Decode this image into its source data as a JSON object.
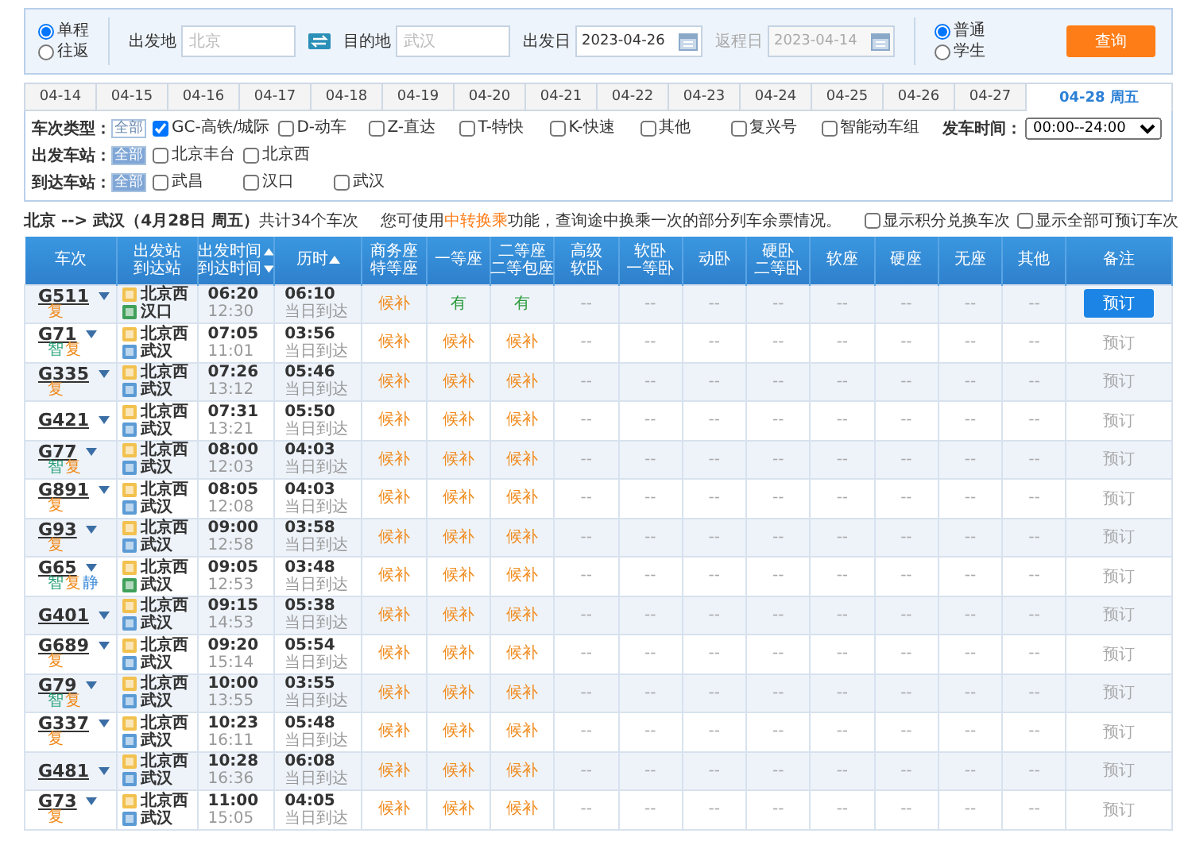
{
  "trip_type": [
    {
      "label": "单程",
      "selected": true
    },
    {
      "label": "往返",
      "selected": false
    }
  ],
  "from": {
    "label": "出发地",
    "placeholder": "北京"
  },
  "to": {
    "label": "目的地",
    "placeholder": "武汉"
  },
  "depart_date": {
    "label": "出发日",
    "value": "2023-04-26",
    "disabled": false
  },
  "return_date": {
    "label": "返程日",
    "value": "2023-04-14",
    "disabled": true
  },
  "passenger": [
    {
      "label": "普通",
      "selected": true
    },
    {
      "label": "学生",
      "selected": false
    }
  ],
  "search_button": "查询",
  "date_tabs": [
    {
      "label": "04-14",
      "selected": false
    },
    {
      "label": "04-15",
      "selected": false
    },
    {
      "label": "04-16",
      "selected": false
    },
    {
      "label": "04-17",
      "selected": false
    },
    {
      "label": "04-18",
      "selected": false
    },
    {
      "label": "04-19",
      "selected": false
    },
    {
      "label": "04-20",
      "selected": false
    },
    {
      "label": "04-21",
      "selected": false
    },
    {
      "label": "04-22",
      "selected": false
    },
    {
      "label": "04-23",
      "selected": false
    },
    {
      "label": "04-24",
      "selected": false
    },
    {
      "label": "04-25",
      "selected": false
    },
    {
      "label": "04-26",
      "selected": false
    },
    {
      "label": "04-27",
      "selected": false
    },
    {
      "label": "04-28 周五",
      "selected": true
    }
  ],
  "filters": {
    "rows": [
      {
        "label": "车次类型：",
        "all": {
          "label": "全部",
          "selected": false
        },
        "options": [
          {
            "label": "GC-高铁/城际",
            "checked": true
          },
          {
            "label": "D-动车",
            "checked": false
          },
          {
            "label": "Z-直达",
            "checked": false
          },
          {
            "label": "T-特快",
            "checked": false
          },
          {
            "label": "K-快速",
            "checked": false
          },
          {
            "label": "其他",
            "checked": false
          },
          {
            "label": "复兴号",
            "checked": false
          },
          {
            "label": "智能动车组",
            "checked": false
          }
        ]
      },
      {
        "label": "出发车站：",
        "all": {
          "label": "全部",
          "selected": true
        },
        "options": [
          {
            "label": "北京丰台",
            "checked": false
          },
          {
            "label": "北京西",
            "checked": false
          }
        ]
      },
      {
        "label": "到达车站：",
        "all": {
          "label": "全部",
          "selected": true
        },
        "options": [
          {
            "label": "武昌",
            "checked": false
          },
          {
            "label": "汉口",
            "checked": false
          },
          {
            "label": "武汉",
            "checked": false
          }
        ]
      }
    ],
    "time": {
      "label": "发车时间：",
      "value": "00:00--24:00"
    }
  },
  "summary": "**北京 --> 武汉（4月28日 周五）**共计34个车次",
  "notice": {
    "before": "您可使用",
    "link": "中转换乘",
    "after": "功能，查询途中换乘一次的部分列车余票情况。"
  },
  "toggles": [
    {
      "label": "显示积分兑换车次",
      "checked": false
    },
    {
      "label": "显示全部可预订车次",
      "checked": false
    }
  ],
  "table": {
    "columns": [
      {
        "lines": [
          {
            "text": "车次"
          }
        ]
      },
      {
        "lines": [
          {
            "text": "出发站"
          },
          {
            "text": "到达站"
          }
        ]
      },
      {
        "lines": [
          {
            "text": "出发时间",
            "sort_up": true
          },
          {
            "text": "到达时间",
            "sort_up": false
          }
        ]
      },
      {
        "lines": [
          {
            "text": "历时",
            "sort_up": true
          }
        ]
      },
      {
        "lines": [
          {
            "text": "商务座"
          },
          {
            "text": "特等座"
          }
        ]
      },
      {
        "lines": [
          {
            "text": "一等座"
          }
        ]
      },
      {
        "lines": [
          {
            "text": "二等座"
          },
          {
            "text": "二等包座"
          }
        ]
      },
      {
        "lines": [
          {
            "text": "高级"
          },
          {
            "text": "软卧"
          }
        ]
      },
      {
        "lines": [
          {
            "text": "软卧"
          },
          {
            "text": "一等卧"
          }
        ]
      },
      {
        "lines": [
          {
            "text": "动卧"
          }
        ]
      },
      {
        "lines": [
          {
            "text": "硬卧"
          },
          {
            "text": "二等卧"
          }
        ]
      },
      {
        "lines": [
          {
            "text": "软座"
          }
        ]
      },
      {
        "lines": [
          {
            "text": "硬座"
          }
        ]
      },
      {
        "lines": [
          {
            "text": "无座"
          }
        ]
      },
      {
        "lines": [
          {
            "text": "其他"
          }
        ]
      },
      {
        "lines": [
          {
            "text": "备注"
          }
        ]
      }
    ],
    "rows": [
      {
        "train": "G511",
        "tags": [
          {
            "text": "复",
            "kind": "fuxing"
          }
        ],
        "from": {
          "name": "北京西",
          "kind": "start"
        },
        "to": {
          "name": "汉口",
          "kind": "end"
        },
        "depart": "06:20",
        "arrive": "12:30",
        "duration": "06:10",
        "arrival_day": "当日到达",
        "seats": [
          {
            "text": "候补",
            "kind": "waitlist"
          },
          {
            "text": "有",
            "kind": "available"
          },
          {
            "text": "有",
            "kind": "available"
          },
          {
            "text": "--",
            "kind": "none"
          },
          {
            "text": "--",
            "kind": "none"
          },
          {
            "text": "--",
            "kind": "none"
          },
          {
            "text": "--",
            "kind": "none"
          },
          {
            "text": "--",
            "kind": "none"
          },
          {
            "text": "--",
            "kind": "none"
          },
          {
            "text": "--",
            "kind": "none"
          },
          {
            "text": "--",
            "kind": "none"
          }
        ],
        "book": {
          "label": "预订",
          "highlighted": true
        }
      },
      {
        "train": "G71",
        "tags": [
          {
            "text": "智",
            "kind": "smart"
          },
          {
            "text": "复",
            "kind": "fuxing"
          }
        ],
        "from": {
          "name": "北京西",
          "kind": "start"
        },
        "to": {
          "name": "武汉",
          "kind": "pass"
        },
        "depart": "07:05",
        "arrive": "11:01",
        "duration": "03:56",
        "arrival_day": "当日到达",
        "seats": [
          {
            "text": "候补",
            "kind": "waitlist"
          },
          {
            "text": "候补",
            "kind": "waitlist"
          },
          {
            "text": "候补",
            "kind": "waitlist"
          },
          {
            "text": "--",
            "kind": "none"
          },
          {
            "text": "--",
            "kind": "none"
          },
          {
            "text": "--",
            "kind": "none"
          },
          {
            "text": "--",
            "kind": "none"
          },
          {
            "text": "--",
            "kind": "none"
          },
          {
            "text": "--",
            "kind": "none"
          },
          {
            "text": "--",
            "kind": "none"
          },
          {
            "text": "--",
            "kind": "none"
          }
        ],
        "book": {
          "label": "预订",
          "highlighted": false
        }
      },
      {
        "train": "G335",
        "tags": [
          {
            "text": "复",
            "kind": "fuxing"
          }
        ],
        "from": {
          "name": "北京西",
          "kind": "start"
        },
        "to": {
          "name": "武汉",
          "kind": "pass"
        },
        "depart": "07:26",
        "arrive": "13:12",
        "duration": "05:46",
        "arrival_day": "当日到达",
        "seats": [
          {
            "text": "候补",
            "kind": "waitlist"
          },
          {
            "text": "候补",
            "kind": "waitlist"
          },
          {
            "text": "候补",
            "kind": "waitlist"
          },
          {
            "text": "--",
            "kind": "none"
          },
          {
            "text": "--",
            "kind": "none"
          },
          {
            "text": "--",
            "kind": "none"
          },
          {
            "text": "--",
            "kind": "none"
          },
          {
            "text": "--",
            "kind": "none"
          },
          {
            "text": "--",
            "kind": "none"
          },
          {
            "text": "--",
            "kind": "none"
          },
          {
            "text": "--",
            "kind": "none"
          }
        ],
        "book": {
          "label": "预订",
          "highlighted": false
        }
      },
      {
        "train": "G421",
        "tags": [],
        "from": {
          "name": "北京西",
          "kind": "start"
        },
        "to": {
          "name": "武汉",
          "kind": "pass"
        },
        "depart": "07:31",
        "arrive": "13:21",
        "duration": "05:50",
        "arrival_day": "当日到达",
        "seats": [
          {
            "text": "候补",
            "kind": "waitlist"
          },
          {
            "text": "候补",
            "kind": "waitlist"
          },
          {
            "text": "候补",
            "kind": "waitlist"
          },
          {
            "text": "--",
            "kind": "none"
          },
          {
            "text": "--",
            "kind": "none"
          },
          {
            "text": "--",
            "kind": "none"
          },
          {
            "text": "--",
            "kind": "none"
          },
          {
            "text": "--",
            "kind": "none"
          },
          {
            "text": "--",
            "kind": "none"
          },
          {
            "text": "--",
            "kind": "none"
          },
          {
            "text": "--",
            "kind": "none"
          }
        ],
        "book": {
          "label": "预订",
          "highlighted": false
        }
      },
      {
        "train": "G77",
        "tags": [
          {
            "text": "智",
            "kind": "smart"
          },
          {
            "text": "复",
            "kind": "fuxing"
          }
        ],
        "from": {
          "name": "北京西",
          "kind": "start"
        },
        "to": {
          "name": "武汉",
          "kind": "pass"
        },
        "depart": "08:00",
        "arrive": "12:03",
        "duration": "04:03",
        "arrival_day": "当日到达",
        "seats": [
          {
            "text": "候补",
            "kind": "waitlist"
          },
          {
            "text": "候补",
            "kind": "waitlist"
          },
          {
            "text": "候补",
            "kind": "waitlist"
          },
          {
            "text": "--",
            "kind": "none"
          },
          {
            "text": "--",
            "kind": "none"
          },
          {
            "text": "--",
            "kind": "none"
          },
          {
            "text": "--",
            "kind": "none"
          },
          {
            "text": "--",
            "kind": "none"
          },
          {
            "text": "--",
            "kind": "none"
          },
          {
            "text": "--",
            "kind": "none"
          },
          {
            "text": "--",
            "kind": "none"
          }
        ],
        "book": {
          "label": "预订",
          "highlighted": false
        }
      },
      {
        "train": "G891",
        "tags": [
          {
            "text": "复",
            "kind": "fuxing"
          }
        ],
        "from": {
          "name": "北京西",
          "kind": "start"
        },
        "to": {
          "name": "武汉",
          "kind": "pass"
        },
        "depart": "08:05",
        "arrive": "12:08",
        "duration": "04:03",
        "arrival_day": "当日到达",
        "seats": [
          {
            "text": "候补",
            "kind": "waitlist"
          },
          {
            "text": "候补",
            "kind": "waitlist"
          },
          {
            "text": "候补",
            "kind": "waitlist"
          },
          {
            "text": "--",
            "kind": "none"
          },
          {
            "text": "--",
            "kind": "none"
          },
          {
            "text": "--",
            "kind": "none"
          },
          {
            "text": "--",
            "kind": "none"
          },
          {
            "text": "--",
            "kind": "none"
          },
          {
            "text": "--",
            "kind": "none"
          },
          {
            "text": "--",
            "kind": "none"
          },
          {
            "text": "--",
            "kind": "none"
          }
        ],
        "book": {
          "label": "预订",
          "highlighted": false
        }
      },
      {
        "train": "G93",
        "tags": [
          {
            "text": "复",
            "kind": "fuxing"
          }
        ],
        "from": {
          "name": "北京西",
          "kind": "start"
        },
        "to": {
          "name": "武汉",
          "kind": "pass"
        },
        "depart": "09:00",
        "arrive": "12:58",
        "duration": "03:58",
        "arrival_day": "当日到达",
        "seats": [
          {
            "text": "候补",
            "kind": "waitlist"
          },
          {
            "text": "候补",
            "kind": "waitlist"
          },
          {
            "text": "候补",
            "kind": "waitlist"
          },
          {
            "text": "--",
            "kind": "none"
          },
          {
            "text": "--",
            "kind": "none"
          },
          {
            "text": "--",
            "kind": "none"
          },
          {
            "text": "--",
            "kind": "none"
          },
          {
            "text": "--",
            "kind": "none"
          },
          {
            "text": "--",
            "kind": "none"
          },
          {
            "text": "--",
            "kind": "none"
          },
          {
            "text": "--",
            "kind": "none"
          }
        ],
        "book": {
          "label": "预订",
          "highlighted": false
        }
      },
      {
        "train": "G65",
        "tags": [
          {
            "text": "智",
            "kind": "smart"
          },
          {
            "text": "复",
            "kind": "fuxing"
          },
          {
            "text": "静",
            "kind": "quiet"
          }
        ],
        "from": {
          "name": "北京西",
          "kind": "start"
        },
        "to": {
          "name": "武汉",
          "kind": "end"
        },
        "depart": "09:05",
        "arrive": "12:53",
        "duration": "03:48",
        "arrival_day": "当日到达",
        "seats": [
          {
            "text": "候补",
            "kind": "waitlist"
          },
          {
            "text": "候补",
            "kind": "waitlist"
          },
          {
            "text": "候补",
            "kind": "waitlist"
          },
          {
            "text": "--",
            "kind": "none"
          },
          {
            "text": "--",
            "kind": "none"
          },
          {
            "text": "--",
            "kind": "none"
          },
          {
            "text": "--",
            "kind": "none"
          },
          {
            "text": "--",
            "kind": "none"
          },
          {
            "text": "--",
            "kind": "none"
          },
          {
            "text": "--",
            "kind": "none"
          },
          {
            "text": "--",
            "kind": "none"
          }
        ],
        "book": {
          "label": "预订",
          "highlighted": false
        }
      },
      {
        "train": "G401",
        "tags": [],
        "from": {
          "name": "北京西",
          "kind": "start"
        },
        "to": {
          "name": "武汉",
          "kind": "pass"
        },
        "depart": "09:15",
        "arrive": "14:53",
        "duration": "05:38",
        "arrival_day": "当日到达",
        "seats": [
          {
            "text": "候补",
            "kind": "waitlist"
          },
          {
            "text": "候补",
            "kind": "waitlist"
          },
          {
            "text": "候补",
            "kind": "waitlist"
          },
          {
            "text": "--",
            "kind": "none"
          },
          {
            "text": "--",
            "kind": "none"
          },
          {
            "text": "--",
            "kind": "none"
          },
          {
            "text": "--",
            "kind": "none"
          },
          {
            "text": "--",
            "kind": "none"
          },
          {
            "text": "--",
            "kind": "none"
          },
          {
            "text": "--",
            "kind": "none"
          },
          {
            "text": "--",
            "kind": "none"
          }
        ],
        "book": {
          "label": "预订",
          "highlighted": false
        }
      },
      {
        "train": "G689",
        "tags": [
          {
            "text": "复",
            "kind": "fuxing"
          }
        ],
        "from": {
          "name": "北京西",
          "kind": "start"
        },
        "to": {
          "name": "武汉",
          "kind": "pass"
        },
        "depart": "09:20",
        "arrive": "15:14",
        "duration": "05:54",
        "arrival_day": "当日到达",
        "seats": [
          {
            "text": "候补",
            "kind": "waitlist"
          },
          {
            "text": "候补",
            "kind": "waitlist"
          },
          {
            "text": "候补",
            "kind": "waitlist"
          },
          {
            "text": "--",
            "kind": "none"
          },
          {
            "text": "--",
            "kind": "none"
          },
          {
            "text": "--",
            "kind": "none"
          },
          {
            "text": "--",
            "kind": "none"
          },
          {
            "text": "--",
            "kind": "none"
          },
          {
            "text": "--",
            "kind": "none"
          },
          {
            "text": "--",
            "kind": "none"
          },
          {
            "text": "--",
            "kind": "none"
          }
        ],
        "book": {
          "label": "预订",
          "highlighted": false
        }
      },
      {
        "train": "G79",
        "tags": [
          {
            "text": "智",
            "kind": "smart"
          },
          {
            "text": "复",
            "kind": "fuxing"
          }
        ],
        "from": {
          "name": "北京西",
          "kind": "start"
        },
        "to": {
          "name": "武汉",
          "kind": "pass"
        },
        "depart": "10:00",
        "arrive": "13:55",
        "duration": "03:55",
        "arrival_day": "当日到达",
        "seats": [
          {
            "text": "候补",
            "kind": "waitlist"
          },
          {
            "text": "候补",
            "kind": "waitlist"
          },
          {
            "text": "候补",
            "kind": "waitlist"
          },
          {
            "text": "--",
            "kind": "none"
          },
          {
            "text": "--",
            "kind": "none"
          },
          {
            "text": "--",
            "kind": "none"
          },
          {
            "text": "--",
            "kind": "none"
          },
          {
            "text": "--",
            "kind": "none"
          },
          {
            "text": "--",
            "kind": "none"
          },
          {
            "text": "--",
            "kind": "none"
          },
          {
            "text": "--",
            "kind": "none"
          }
        ],
        "book": {
          "label": "预订",
          "highlighted": false
        }
      },
      {
        "train": "G337",
        "tags": [
          {
            "text": "复",
            "kind": "fuxing"
          }
        ],
        "from": {
          "name": "北京西",
          "kind": "start"
        },
        "to": {
          "name": "武汉",
          "kind": "pass"
        },
        "depart": "10:23",
        "arrive": "16:11",
        "duration": "05:48",
        "arrival_day": "当日到达",
        "seats": [
          {
            "text": "候补",
            "kind": "waitlist"
          },
          {
            "text": "候补",
            "kind": "waitlist"
          },
          {
            "text": "候补",
            "kind": "waitlist"
          },
          {
            "text": "--",
            "kind": "none"
          },
          {
            "text": "--",
            "kind": "none"
          },
          {
            "text": "--",
            "kind": "none"
          },
          {
            "text": "--",
            "kind": "none"
          },
          {
            "text": "--",
            "kind": "none"
          },
          {
            "text": "--",
            "kind": "none"
          },
          {
            "text": "--",
            "kind": "none"
          },
          {
            "text": "--",
            "kind": "none"
          }
        ],
        "book": {
          "label": "预订",
          "highlighted": false
        }
      },
      {
        "train": "G481",
        "tags": [],
        "from": {
          "name": "北京西",
          "kind": "start"
        },
        "to": {
          "name": "武汉",
          "kind": "pass"
        },
        "depart": "10:28",
        "arrive": "16:36",
        "duration": "06:08",
        "arrival_day": "当日到达",
        "seats": [
          {
            "text": "候补",
            "kind": "waitlist"
          },
          {
            "text": "候补",
            "kind": "waitlist"
          },
          {
            "text": "候补",
            "kind": "waitlist"
          },
          {
            "text": "--",
            "kind": "none"
          },
          {
            "text": "--",
            "kind": "none"
          },
          {
            "text": "--",
            "kind": "none"
          },
          {
            "text": "--",
            "kind": "none"
          },
          {
            "text": "--",
            "kind": "none"
          },
          {
            "text": "--",
            "kind": "none"
          },
          {
            "text": "--",
            "kind": "none"
          },
          {
            "text": "--",
            "kind": "none"
          }
        ],
        "book": {
          "label": "预订",
          "highlighted": false
        }
      },
      {
        "train": "G73",
        "tags": [
          {
            "text": "复",
            "kind": "fuxing"
          }
        ],
        "from": {
          "name": "北京西",
          "kind": "start"
        },
        "to": {
          "name": "武汉",
          "kind": "pass"
        },
        "depart": "11:00",
        "arrive": "15:05",
        "duration": "04:05",
        "arrival_day": "当日到达",
        "seats": [
          {
            "text": "候补",
            "kind": "waitlist"
          },
          {
            "text": "候补",
            "kind": "waitlist"
          },
          {
            "text": "候补",
            "kind": "waitlist"
          },
          {
            "text": "--",
            "kind": "none"
          },
          {
            "text": "--",
            "kind": "none"
          },
          {
            "text": "--",
            "kind": "none"
          },
          {
            "text": "--",
            "kind": "none"
          },
          {
            "text": "--",
            "kind": "none"
          },
          {
            "text": "--",
            "kind": "none"
          },
          {
            "text": "--",
            "kind": "none"
          },
          {
            "text": "--",
            "kind": "none"
          }
        ],
        "book": {
          "label": "预订",
          "highlighted": false
        }
      }
    ]
  }
}
